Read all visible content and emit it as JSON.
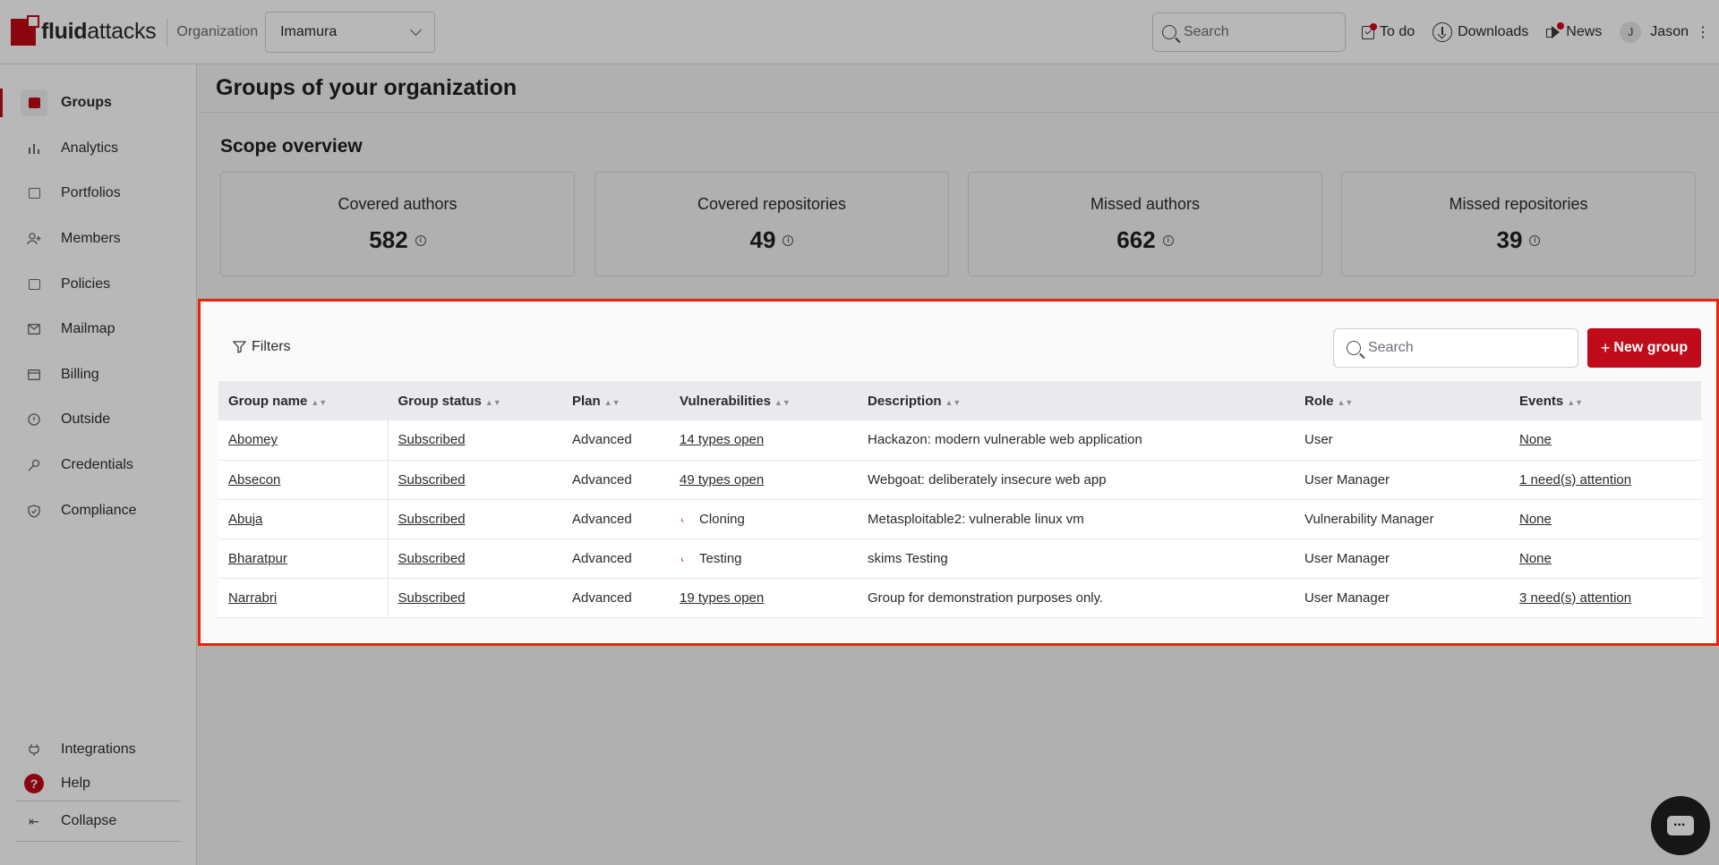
{
  "header": {
    "logo_bold": "fluid",
    "logo_rest": "attacks",
    "org_label": "Organization",
    "org_value": "Imamura",
    "search_placeholder": "Search",
    "todo": "To do",
    "downloads": "Downloads",
    "news": "News",
    "avatar_initial": "J",
    "user": "Jason"
  },
  "sidebar": {
    "items": [
      {
        "label": "Groups",
        "icon": "folder-icon"
      },
      {
        "label": "Analytics",
        "icon": "chart-icon"
      },
      {
        "label": "Portfolios",
        "icon": "briefcase-icon"
      },
      {
        "label": "Members",
        "icon": "user-plus-icon"
      },
      {
        "label": "Policies",
        "icon": "policy-icon"
      },
      {
        "label": "Mailmap",
        "icon": "mail-icon"
      },
      {
        "label": "Billing",
        "icon": "billing-icon"
      },
      {
        "label": "Outside",
        "icon": "outside-icon"
      },
      {
        "label": "Credentials",
        "icon": "key-icon"
      },
      {
        "label": "Compliance",
        "icon": "shield-icon"
      }
    ],
    "integrations": "Integrations",
    "help": "Help",
    "help_glyph": "?",
    "collapse": "Collapse"
  },
  "main": {
    "page_title": "Groups of your organization",
    "scope_title": "Scope overview",
    "cards": [
      {
        "label": "Covered authors",
        "value": "582"
      },
      {
        "label": "Covered repositories",
        "value": "49"
      },
      {
        "label": "Missed authors",
        "value": "662"
      },
      {
        "label": "Missed repositories",
        "value": "39"
      }
    ],
    "filters": "Filters",
    "search_placeholder": "Search",
    "new_group": "New group",
    "columns": [
      "Group name",
      "Group status",
      "Plan",
      "Vulnerabilities",
      "Description",
      "Role",
      "Events"
    ],
    "rows": [
      {
        "name": "Abomey",
        "status": "Subscribed",
        "plan": "Advanced",
        "vulns": "14 types open",
        "vulns_loading": false,
        "description": "Hackazon: modern vulnerable web application",
        "role": "User",
        "events": "None"
      },
      {
        "name": "Absecon",
        "status": "Subscribed",
        "plan": "Advanced",
        "vulns": "49 types open",
        "vulns_loading": false,
        "description": "Webgoat: deliberately insecure web app",
        "role": "User Manager",
        "events": "1 need(s) attention"
      },
      {
        "name": "Abuja",
        "status": "Subscribed",
        "plan": "Advanced",
        "vulns": "Cloning",
        "vulns_loading": true,
        "description": "Metasploitable2: vulnerable linux vm",
        "role": "Vulnerability Manager",
        "events": "None"
      },
      {
        "name": "Bharatpur",
        "status": "Subscribed",
        "plan": "Advanced",
        "vulns": "Testing",
        "vulns_loading": true,
        "description": "skims Testing",
        "role": "User Manager",
        "events": "None"
      },
      {
        "name": "Narrabri",
        "status": "Subscribed",
        "plan": "Advanced",
        "vulns": "19 types open",
        "vulns_loading": false,
        "description": "Group for demonstration purposes only.",
        "role": "User Manager",
        "events": "3 need(s) attention"
      }
    ]
  },
  "colors": {
    "brand": "#bf0b1a",
    "highlight": "#f0200b"
  }
}
